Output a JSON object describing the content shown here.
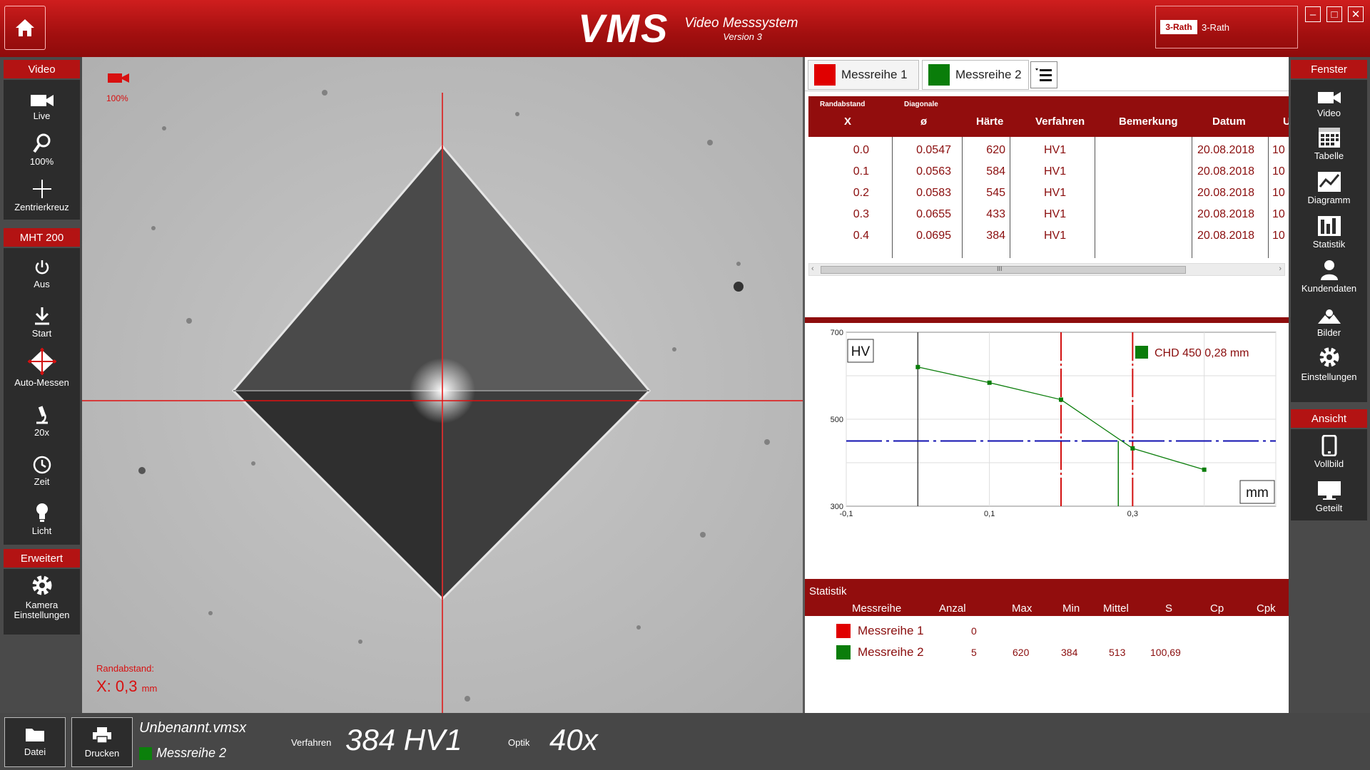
{
  "app": {
    "logo": "VMS",
    "subtitle": "Video Messsystem",
    "version": "Version 3",
    "user_logo": "3-Rath",
    "user": "3-Rath"
  },
  "window": {
    "minimize": "–",
    "maximize": "□",
    "close": "✕"
  },
  "left": {
    "video_header": "Video",
    "live": "Live",
    "zoom": "100%",
    "crosshair": "Zentrierkreuz",
    "mht_header": "MHT 200",
    "off": "Aus",
    "start": "Start",
    "auto": "Auto-Messen",
    "objective": "20x",
    "time": "Zeit",
    "light": "Licht",
    "ext_header": "Erweitert",
    "camera_line1": "Kamera",
    "camera_line2": "Einstellungen"
  },
  "right": {
    "window_header": "Fenster",
    "video": "Video",
    "table": "Tabelle",
    "diagram": "Diagramm",
    "stats": "Statistik",
    "customer": "Kundendaten",
    "images": "Bilder",
    "settings": "Einstellungen",
    "view_header": "Ansicht",
    "full": "Vollbild",
    "split": "Geteilt"
  },
  "overlay": {
    "zoom": "100%",
    "rand_label": "Randabstand:",
    "rand_value": "X: 0,3",
    "rand_unit": "mm"
  },
  "tabs": [
    {
      "label": "Messreihe 1",
      "color": "#e00000"
    },
    {
      "label": "Messreihe 2",
      "color": "#0a7d0a"
    }
  ],
  "table": {
    "sub_headers": [
      "Randabstand",
      "Diagonale"
    ],
    "headers": [
      "X",
      "ø",
      "Härte",
      "Verfahren",
      "Bemerkung",
      "Datum",
      "U"
    ],
    "rows": [
      [
        "0.0",
        "0.0547",
        "620",
        "HV1",
        "",
        "20.08.2018",
        "10"
      ],
      [
        "0.1",
        "0.0563",
        "584",
        "HV1",
        "",
        "20.08.2018",
        "10"
      ],
      [
        "0.2",
        "0.0583",
        "545",
        "HV1",
        "",
        "20.08.2018",
        "10"
      ],
      [
        "0.3",
        "0.0655",
        "433",
        "HV1",
        "",
        "20.08.2018",
        "10"
      ],
      [
        "0.4",
        "0.0695",
        "384",
        "HV1",
        "",
        "20.08.2018",
        "10"
      ]
    ],
    "scroll_left": "‹",
    "scroll_right": "›",
    "scroll_grip": "III"
  },
  "chart_data": {
    "type": "line",
    "ylabel": "HV",
    "xlabel": "mm",
    "xlim": [
      -0.1,
      0.5
    ],
    "ylim": [
      300,
      700
    ],
    "yticks": [
      "700",
      "500",
      "300"
    ],
    "xticks": [
      {
        "v": -0.1,
        "label": "-0,1"
      },
      {
        "v": 0.1,
        "label": "0,1"
      },
      {
        "v": 0.3,
        "label": "0,3"
      }
    ],
    "threshold": 450,
    "chd": 0.28,
    "red_lines": [
      0.2,
      0.3
    ],
    "legend": "CHD 450 0,28 mm",
    "series": [
      {
        "color": "#0a7d0a",
        "x": [
          0.0,
          0.1,
          0.2,
          0.3,
          0.4
        ],
        "y": [
          620,
          584,
          545,
          433,
          384
        ]
      }
    ]
  },
  "stats": {
    "title": "Statistik",
    "headers": [
      "Messreihe",
      "Anzal",
      "Max",
      "Min",
      "Mittel",
      "S",
      "Cp",
      "Cpk"
    ],
    "rows": [
      {
        "name": "Messreihe 1",
        "color": "#e00000",
        "anzal": "0",
        "max": "",
        "min": "",
        "mittel": "",
        "s": ""
      },
      {
        "name": "Messreihe 2",
        "color": "#0a7d0a",
        "anzal": "5",
        "max": "620",
        "min": "384",
        "mittel": "513",
        "s": "100,69"
      }
    ]
  },
  "bottom": {
    "file_btn": "Datei",
    "print_btn": "Drucken",
    "filename": "Unbenannt.vmsx",
    "series": "Messreihe 2",
    "method_label": "Verfahren",
    "method_value": "384 HV1",
    "optics_label": "Optik",
    "optics_value": "40x"
  }
}
